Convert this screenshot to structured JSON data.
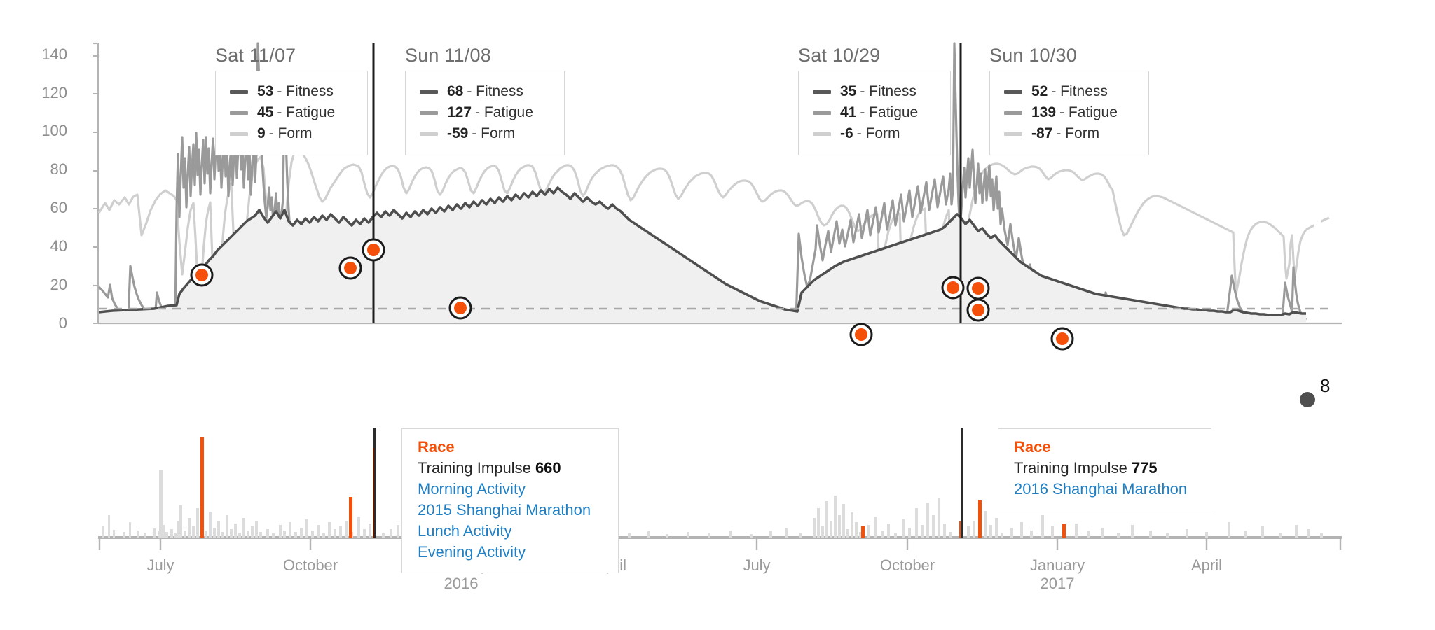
{
  "chart_data": {
    "type": "line",
    "title": "",
    "xlabel": "",
    "ylabel": "",
    "ylim": [
      0,
      148
    ],
    "xlim": [
      "2015-05",
      "2017-06"
    ],
    "grid": false,
    "legend_position": "floating-tooltips",
    "y_ticks": [
      "0",
      "20",
      "40",
      "60",
      "80",
      "100",
      "120",
      "140"
    ],
    "y_tick_values": [
      0,
      20,
      40,
      60,
      80,
      100,
      120,
      140
    ],
    "x_ticks": [
      {
        "label": "July",
        "year": ""
      },
      {
        "label": "October",
        "year": ""
      },
      {
        "label": "January",
        "year": "2016"
      },
      {
        "label": "April",
        "year": ""
      },
      {
        "label": "July",
        "year": ""
      },
      {
        "label": "October",
        "year": ""
      },
      {
        "label": "January",
        "year": "2017"
      },
      {
        "label": "April",
        "year": ""
      }
    ],
    "series": [
      {
        "name": "Fitness",
        "color": "#595959"
      },
      {
        "name": "Fatigue",
        "color": "#9a9a9a"
      },
      {
        "name": "Form",
        "color": "#cfcfcf"
      }
    ],
    "threshold_line": 8,
    "end_marker": {
      "label": "8",
      "series": "Fitness",
      "value": 8
    }
  },
  "colors": {
    "fitness": "#595959",
    "fatigue": "#9a9a9a",
    "form": "#cfcfcf",
    "race": "#f4500a",
    "impulse_bar": "#dcdcdc",
    "link": "#1f7fc4",
    "axis": "#b4b4b4",
    "marker_fill": "#f4500a",
    "marker_ring": "#ffffff",
    "marker_stroke": "#1c1c1c"
  },
  "tooltips": [
    {
      "title": "Sat 11/07",
      "rows": [
        {
          "value": "53",
          "label": "- Fitness",
          "swatch": "fitness"
        },
        {
          "value": "45",
          "label": "- Fatigue",
          "swatch": "fatigue"
        },
        {
          "value": "9",
          "label": "- Form",
          "swatch": "form"
        }
      ]
    },
    {
      "title": "Sun 11/08",
      "rows": [
        {
          "value": "68",
          "label": "- Fitness",
          "swatch": "fitness"
        },
        {
          "value": "127",
          "label": "- Fatigue",
          "swatch": "fatigue"
        },
        {
          "value": "-59",
          "label": "- Form",
          "swatch": "form"
        }
      ]
    },
    {
      "title": "Sat 10/29",
      "rows": [
        {
          "value": "35",
          "label": "- Fitness",
          "swatch": "fitness"
        },
        {
          "value": "41",
          "label": "- Fatigue",
          "swatch": "fatigue"
        },
        {
          "value": "-6",
          "label": "- Form",
          "swatch": "form"
        }
      ]
    },
    {
      "title": "Sun 10/30",
      "rows": [
        {
          "value": "52",
          "label": "- Fitness",
          "swatch": "fitness"
        },
        {
          "value": "139",
          "label": "- Fatigue",
          "swatch": "fatigue"
        },
        {
          "value": "-87",
          "label": "- Form",
          "swatch": "form"
        }
      ]
    }
  ],
  "race_cards": [
    {
      "header": "Race",
      "impulse_label": "Training Impulse",
      "impulse_value": "660",
      "activities": [
        "Morning Activity",
        "2015 Shanghai Marathon",
        "Lunch Activity",
        "Evening Activity"
      ]
    },
    {
      "header": "Race",
      "impulse_label": "Training Impulse",
      "impulse_value": "775",
      "activities": [
        "2016 Shanghai Marathon"
      ]
    }
  ]
}
